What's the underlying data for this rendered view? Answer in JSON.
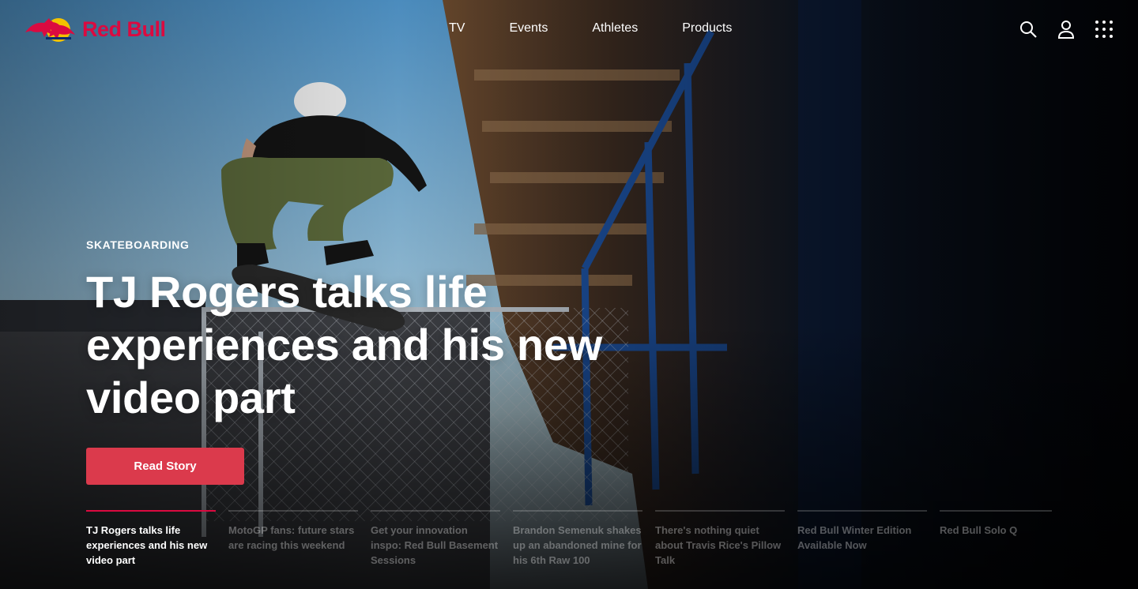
{
  "brand": {
    "name": "Red Bull",
    "color": "#db0a40"
  },
  "nav": {
    "items": [
      "TV",
      "Events",
      "Athletes",
      "Products"
    ]
  },
  "header_icons": [
    "search-icon",
    "user-icon",
    "app-grid-icon"
  ],
  "hero": {
    "category": "SKATEBOARDING",
    "headline": "TJ Rogers talks life experiences and his new video part",
    "cta_label": "Read Story",
    "cta_color": "#db3a4c"
  },
  "stories": [
    {
      "title": "TJ Rogers talks life experiences and his new video part",
      "active": true
    },
    {
      "title": "MotoGP fans: future stars are racing this weekend",
      "active": false
    },
    {
      "title": "Get your innovation inspo: Red Bull Basement Sessions",
      "active": false
    },
    {
      "title": "Brandon Semenuk shakes up an abandoned mine for his 6th Raw 100",
      "active": false
    },
    {
      "title": "There's nothing quiet about Travis Rice's Pillow Talk",
      "active": false
    },
    {
      "title": "Red Bull Winter Edition Available Now",
      "active": false
    },
    {
      "title": "Red Bull Solo Q",
      "active": false
    }
  ]
}
